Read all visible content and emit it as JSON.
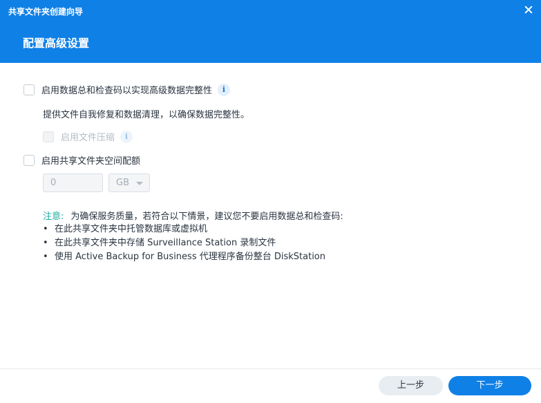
{
  "window": {
    "title": "共享文件夹创建向导"
  },
  "header": {
    "step_title": "配置高级设置"
  },
  "options": {
    "checksum": {
      "label": "启用数据总和检查码以实现高级数据完整性",
      "description": "提供文件自我修复和数据清理，以确保数据完整性。"
    },
    "compression": {
      "label": "启用文件压缩"
    },
    "quota": {
      "label": "启用共享文件夹空间配额",
      "value": "0",
      "unit": "GB"
    }
  },
  "icons": {
    "info": "i"
  },
  "note": {
    "label": "注意:",
    "text": "为确保服务质量，若符合以下情景，建议您不要启用数据总和检查码:",
    "items": [
      "在此共享文件夹中托管数据库或虚拟机",
      "在此共享文件夹中存储 Surveillance Station 录制文件",
      "使用 Active Backup for Business 代理程序备份整台 DiskStation"
    ]
  },
  "footer": {
    "prev_label": "上一步",
    "next_label": "下一步"
  },
  "colors": {
    "brand": "#0f80e6",
    "note_label": "#1fa9a0"
  }
}
